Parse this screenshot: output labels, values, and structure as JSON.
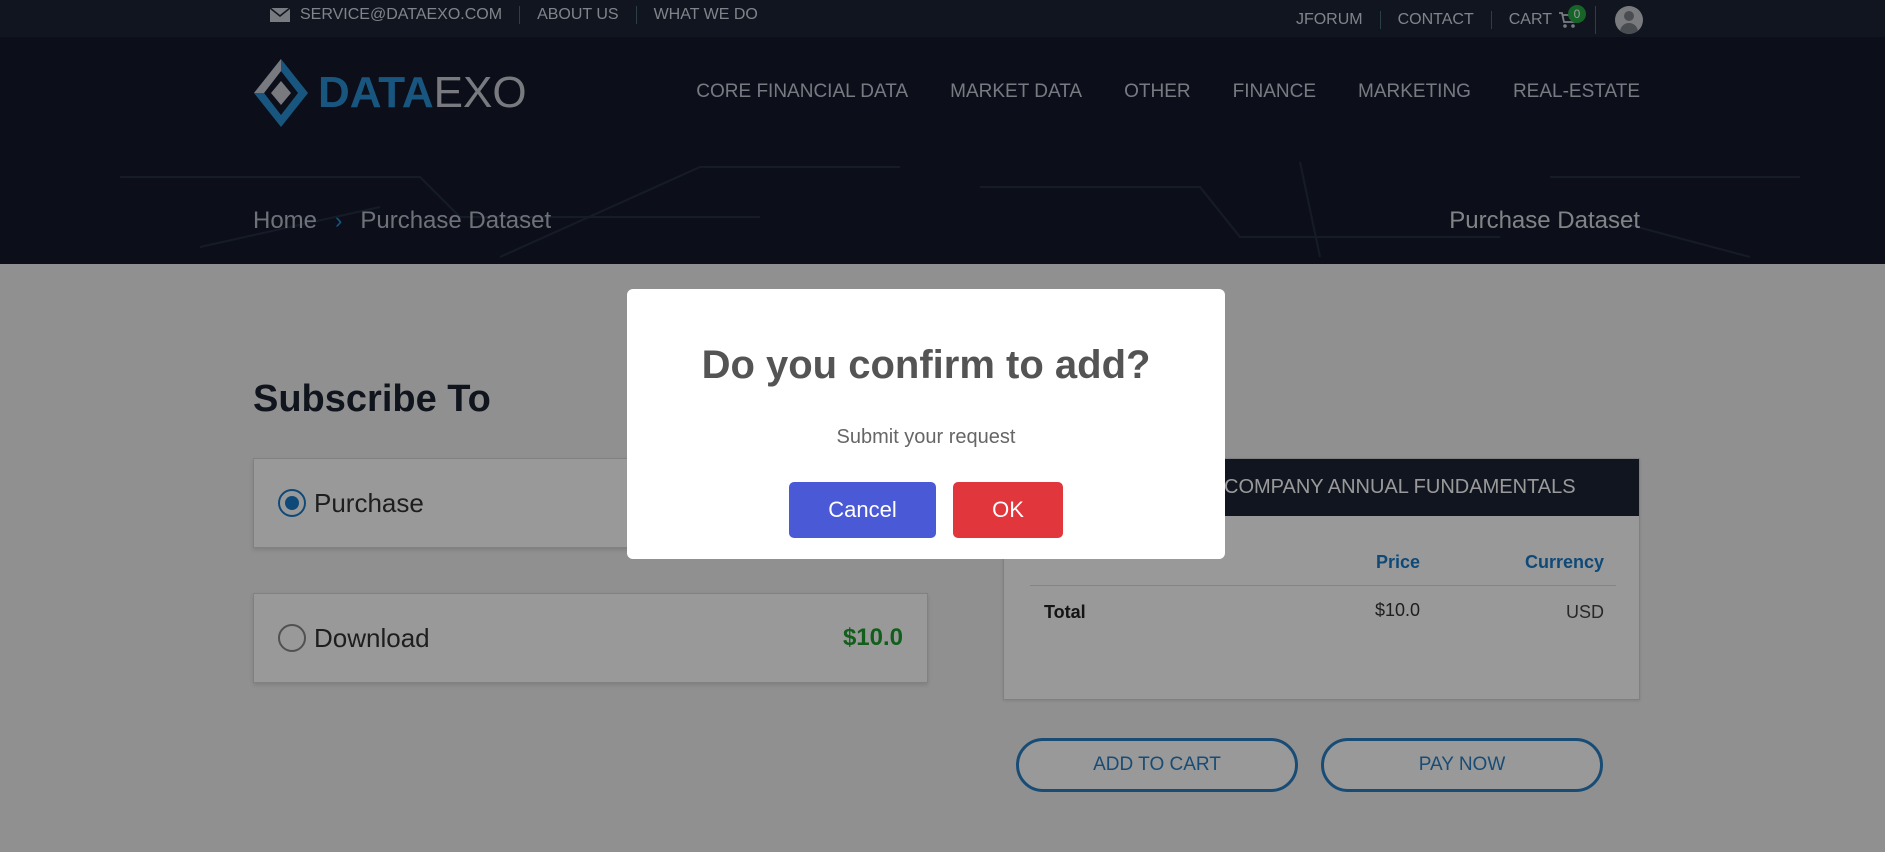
{
  "topbar": {
    "email": "SERVICE@DATAEXO.COM",
    "about": "ABOUT US",
    "what_we_do": "WHAT WE DO",
    "jforum": "JFORUM",
    "contact": "CONTACT",
    "cart": "CART",
    "cart_count": "0"
  },
  "logo": {
    "part1": "DATA",
    "part2": "EXO"
  },
  "nav": {
    "items": [
      "CORE FINANCIAL DATA",
      "MARKET DATA",
      "OTHER",
      "FINANCE",
      "MARKETING",
      "REAL-ESTATE"
    ]
  },
  "breadcrumb": {
    "home": "Home",
    "current": "Purchase Dataset"
  },
  "page_heading": "Purchase Dataset",
  "main": {
    "title": "Subscribe To",
    "options": [
      {
        "label": "Purchase",
        "checked": true,
        "price": ""
      },
      {
        "label": "Download",
        "checked": false,
        "price": "$10.0"
      }
    ]
  },
  "summary": {
    "heading": "C COMPANY ANNUAL FUNDAMENTALS",
    "col_price": "Price",
    "col_currency": "Currency",
    "row_label": "Total",
    "row_price": "$10.0",
    "row_currency": "USD"
  },
  "actions": {
    "add_to_cart": "ADD TO CART",
    "pay_now": "PAY NOW"
  },
  "modal": {
    "title": "Do you confirm to add?",
    "text": "Submit your request",
    "cancel": "Cancel",
    "ok": "OK"
  },
  "colors": {
    "accent": "#1a7bc9",
    "header_bg": "#141a2b",
    "price_green": "#1e9e2e",
    "cancel_blue": "#4a59d6",
    "ok_red": "#e1363b"
  }
}
